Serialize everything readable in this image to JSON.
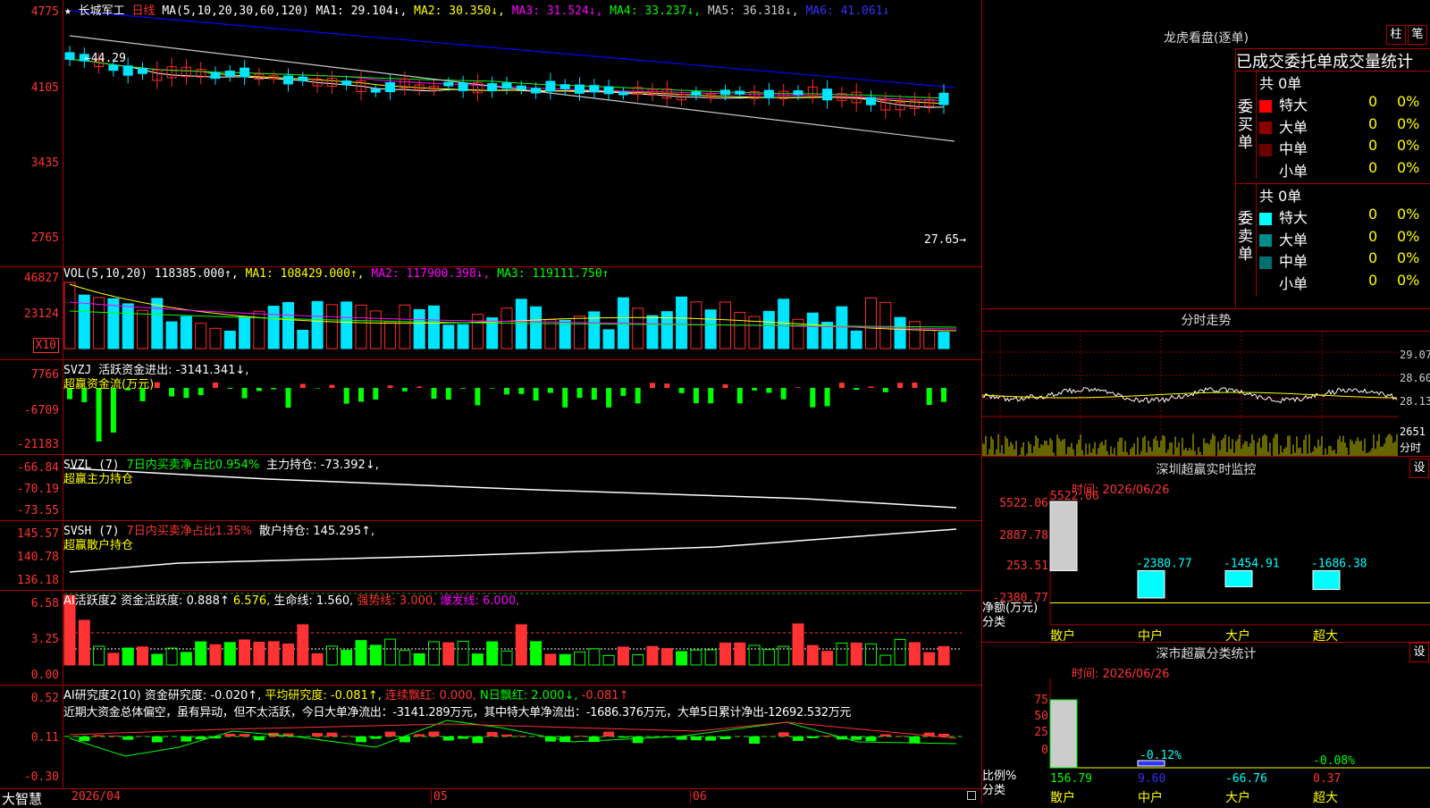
{
  "colors": {
    "up": "#ff2b2b",
    "down": "#00e5ff",
    "bg": "#000000",
    "border": "#aa0000",
    "ma1": "#ffffff",
    "ma2": "#ffff00",
    "ma3": "#ff00ff",
    "ma4": "#00ff00",
    "ma5": "#c8c8c8",
    "ma6": "#0000ff"
  },
  "main": {
    "star": "★",
    "stock_name": "长城军工",
    "period": "日线",
    "ma_label": "MA(5,10,20,30,60,120)",
    "ma1": "MA1: 29.104↓,",
    "ma2": "MA2: 30.350↓,",
    "ma3": "MA3: 31.524↓,",
    "ma4": "MA4: 33.237↓,",
    "ma5": "MA5: 36.318↓,",
    "ma6": "MA6: 41.061↓",
    "y_ticks": [
      "4775",
      "4105",
      "3435",
      "2765"
    ],
    "high_label": "←44.29",
    "low_label": "27.65→"
  },
  "vol": {
    "label": "VOL(5,10,20)",
    "value": "118385.000↑,",
    "ma1": "MA1: 108429.000↑,",
    "ma2": "MA2: 117900.398↓,",
    "ma3": "MA3: 119111.750↑",
    "y_ticks": [
      "46827",
      "23124"
    ],
    "unit": "X10"
  },
  "svzj": {
    "label": "SVZJ",
    "text": "活跃资金进出: -3141.341↓,",
    "sub": "超赢资金流(万元)",
    "y_ticks": [
      "7766",
      "-6709",
      "-21183"
    ]
  },
  "svzl": {
    "label": "SVZL (7)",
    "text1": "7日内买卖净占比0.954%",
    "text2": "主力持仓: -73.392↓,",
    "sub": "超赢主力持仓",
    "y_ticks": [
      "-66.84",
      "-70.19",
      "-73.55"
    ]
  },
  "svsh": {
    "label": "SVSH (7)",
    "text1": "7日内买卖净占比1.35%",
    "text2": "散户持仓: 145.295↑,",
    "sub": "超赢散户持仓",
    "y_ticks": [
      "145.57",
      "140.78",
      "136.18"
    ]
  },
  "ai_active": {
    "label": "AI活跃度2",
    "t1": "资金活跃度: 0.888↑",
    "t2": "6.576,",
    "t3": "生命线: 1.560,",
    "t4": "强势线: 3.000,",
    "t5": "爆发线: 6.000,",
    "y_ticks": [
      "6.58",
      "3.25",
      "0.00"
    ]
  },
  "ai_research": {
    "label": "AI研究度2(10)",
    "t1": "资金研究度: -0.020↑,",
    "t2": "平均研究度: -0.081↑,",
    "t3": "连续飘红: 0.000,",
    "t4": "N日飘红: 2.000↓,",
    "t5": "-0.081↑",
    "comment": "近期大资金总体偏空，虽有异动，但不太活跃，今日大单净流出：-3141.289万元，其中特大单净流出：-1686.376万元，大单5日累计净出-12692.532万元",
    "y_ticks": [
      "0.52",
      "0.11",
      "-0.30"
    ]
  },
  "x_axis": {
    "labels": [
      "2026/04",
      "05",
      "06"
    ]
  },
  "footer": {
    "brand": "大智慧"
  },
  "dragon": {
    "title": "龙虎看盘(逐单)",
    "btn1": "柱",
    "btn2": "笔",
    "stat_title": "已成交委托单成交量统计",
    "buy_side": "委买单",
    "sell_side": "委卖单",
    "buy_total": "共 0单",
    "sell_total": "共 0单",
    "buy_rows": [
      {
        "name": "特大",
        "count": "0",
        "pct": "0%",
        "color": "#ff0000"
      },
      {
        "name": "大单",
        "count": "0",
        "pct": "0%",
        "color": "#8b0000"
      },
      {
        "name": "中单",
        "count": "0",
        "pct": "0%",
        "color": "#6b0000"
      },
      {
        "name": "小单",
        "count": "0",
        "pct": "0%",
        "color": "#000000"
      }
    ],
    "sell_rows": [
      {
        "name": "特大",
        "count": "0",
        "pct": "0%",
        "color": "#00ffff"
      },
      {
        "name": "大单",
        "count": "0",
        "pct": "0%",
        "color": "#008b8b"
      },
      {
        "name": "中单",
        "count": "0",
        "pct": "0%",
        "color": "#007070"
      },
      {
        "name": "小单",
        "count": "0",
        "pct": "0%",
        "color": "#000000"
      }
    ]
  },
  "intraday": {
    "title": "分时走势",
    "prices": [
      "29.07",
      "28.60",
      "28.13"
    ],
    "volume": "2651",
    "volume_label": "分时"
  },
  "monitor": {
    "title": "深圳超赢实时监控",
    "set": "设",
    "time": "时间: 2026/06/26",
    "top_value": "5522.06",
    "y_ticks": [
      "5522.06",
      "2887.78",
      "253.51",
      "-2380.77"
    ],
    "unit1": "净额(万元)",
    "unit2": "分类",
    "bars": [
      {
        "name": "散户",
        "value": "5522.06"
      },
      {
        "name": "中户",
        "value": "-2380.77"
      },
      {
        "name": "大户",
        "value": "-1454.91"
      },
      {
        "name": "超大",
        "value": "-1686.38"
      }
    ]
  },
  "classify": {
    "title": "深市超赢分类统计",
    "set": "设",
    "time": "时间: 2026/06/26",
    "y_ticks": [
      "75",
      "50",
      "25",
      "0"
    ],
    "unit1": "比例%",
    "unit2": "分类",
    "bars": [
      {
        "name": "散户",
        "value": "156.79",
        "top": ""
      },
      {
        "name": "中户",
        "value": "9.60",
        "top": "-0.12%"
      },
      {
        "name": "大户",
        "value": "-66.76",
        "top": ""
      },
      {
        "name": "超大",
        "value": "0.37",
        "top": "-0.08%"
      }
    ]
  }
}
